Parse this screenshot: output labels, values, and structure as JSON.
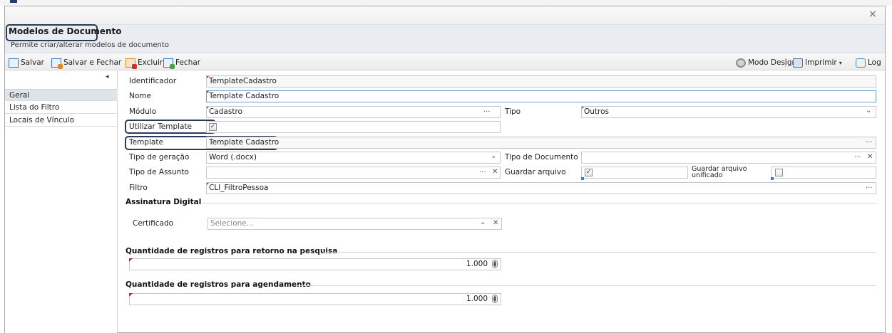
{
  "window": {
    "close_glyph": "×"
  },
  "header": {
    "title": "Modelos de Documento",
    "subtitle": "Permite criar/alterar modelos de documento"
  },
  "toolbar": {
    "save": "Salvar",
    "save_close": "Salvar e Fechar",
    "delete": "Excluir",
    "close": "Fechar",
    "design_mode": "Modo Design",
    "print": "Imprimir",
    "log": "Log",
    "caret": "▾"
  },
  "sidebar": {
    "collapse_glyph": "◂",
    "items": [
      {
        "label": "Geral",
        "active": true
      },
      {
        "label": "Lista do Filtro",
        "active": false
      },
      {
        "label": "Locais de Vínculo",
        "active": false
      }
    ]
  },
  "form": {
    "identificador": {
      "label": "Identificador",
      "value": "TemplateCadastro"
    },
    "nome": {
      "label": "Nome",
      "value": "Template Cadastro"
    },
    "modulo": {
      "label": "Módulo",
      "value": "Cadastro"
    },
    "tipo": {
      "label": "Tipo",
      "value": "Outros"
    },
    "utilizar_template": {
      "label": "Utilizar Template",
      "checked": true
    },
    "template": {
      "label": "Template",
      "value": "Template Cadastro"
    },
    "tipo_geracao": {
      "label": "Tipo de geração",
      "value": "Word (.docx)"
    },
    "tipo_documento": {
      "label": "Tipo de Documento",
      "value": ""
    },
    "tipo_assunto": {
      "label": "Tipo de Assunto",
      "value": ""
    },
    "guardar_arquivo": {
      "label": "Guardar arquivo",
      "checked": true
    },
    "guardar_arquivo_unificado": {
      "label_line1": "Guardar arquivo",
      "label_line2": "unificado",
      "checked": false
    },
    "filtro": {
      "label": "Filtro",
      "value": "CLI_FiltroPessoa"
    }
  },
  "assinatura": {
    "section_title": "Assinatura Digital",
    "certificado_label": "Certificado",
    "certificado_placeholder": "Selecione..."
  },
  "quantidade_pesquisa": {
    "section_title": "Quantidade de registros para retorno na pesquisa",
    "value": "1.000"
  },
  "quantidade_agendamento": {
    "section_title": "Quantidade de registros para agendamento",
    "value": "1.000"
  },
  "glyphs": {
    "ellipsis": "···",
    "dropdown": "⌄",
    "clear": "✕",
    "check": "✓",
    "spin_up": "▲",
    "spin_down": "▼"
  }
}
